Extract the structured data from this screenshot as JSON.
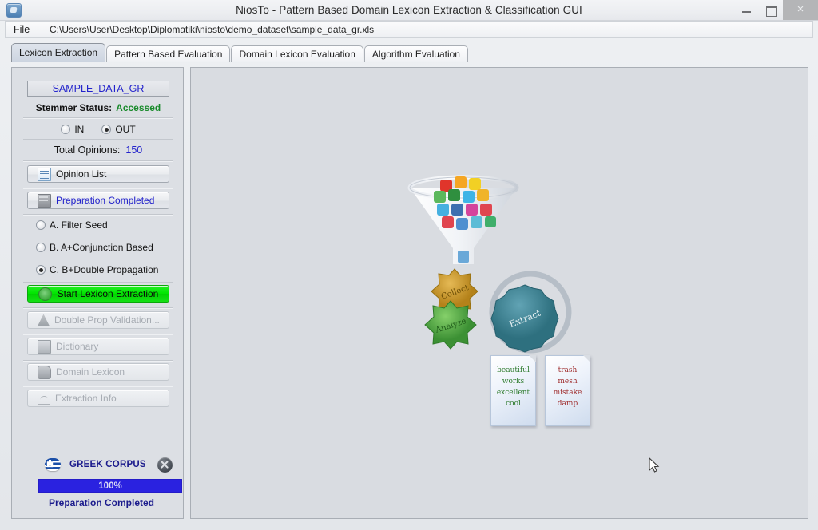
{
  "window": {
    "title": "NiosTo - Pattern Based Domain Lexicon Extraction & Classification GUI",
    "app_icon": "app-window-icon",
    "minimize_label": "",
    "maximize_label": "",
    "close_label": "×"
  },
  "menubar": {
    "file_label": "File",
    "path": "C:\\Users\\User\\Desktop\\Diplomatiki\\niosto\\demo_dataset\\sample_data_gr.xls"
  },
  "tabs": [
    {
      "label": "Lexicon Extraction",
      "active": true
    },
    {
      "label": "Pattern Based Evaluation",
      "active": false
    },
    {
      "label": "Domain Lexicon Evaluation",
      "active": false
    },
    {
      "label": "Algorithm Evaluation",
      "active": false
    }
  ],
  "sidebar": {
    "dataset_name": "SAMPLE_DATA_GR",
    "stemmer_status_label": "Stemmer Status:",
    "stemmer_status_value": "Accessed",
    "inout": [
      {
        "label": "IN",
        "selected": false
      },
      {
        "label": "OUT",
        "selected": true
      }
    ],
    "total_opinions_label": "Total Opinions:",
    "total_opinions_value": "150",
    "opinion_list_button": "Opinion List",
    "preparation_button": "Preparation Completed",
    "methods": [
      {
        "label": "A. Filter Seed",
        "selected": false
      },
      {
        "label": "B. A+Conjunction Based",
        "selected": false
      },
      {
        "label": "C. B+Double Propagation",
        "selected": true
      }
    ],
    "start_button": "Start Lexicon Extraction",
    "disabled_buttons": [
      {
        "label": "Double Prop Validation...",
        "icon": "tree-icon"
      },
      {
        "label": "Dictionary",
        "icon": "book-icon"
      },
      {
        "label": "Domain Lexicon",
        "icon": "cloud-icon"
      },
      {
        "label": "Extraction Info",
        "icon": "chart-icon"
      }
    ],
    "corpus_label": "GREEK CORPUS",
    "corpus_flag_icon": "greek-flag-icon",
    "cancel_icon": "cancel-icon",
    "progress_value": "100%",
    "bottom_status": "Preparation Completed"
  },
  "main": {
    "graphic_alt": "pipeline illustration",
    "funnel_label": "funnel-icon",
    "gears": [
      {
        "label": "Collect",
        "color": "#c8921f"
      },
      {
        "label": "Analyze",
        "color": "#4fa83c"
      },
      {
        "label": "Extract",
        "color": "#3a8294"
      }
    ],
    "notes": [
      {
        "polarity": "positive",
        "words": [
          "beautiful",
          "works",
          "excellent",
          "cool"
        ]
      },
      {
        "polarity": "negative",
        "words": [
          "trash",
          "mesh",
          "mistake",
          "damp"
        ]
      }
    ]
  },
  "colors": {
    "accent_blue": "#2222cc",
    "success_green": "#188a2a",
    "start_green": "#00e500",
    "progress_blue": "#2a22e0",
    "panel_bg": "#dcdfe4"
  }
}
